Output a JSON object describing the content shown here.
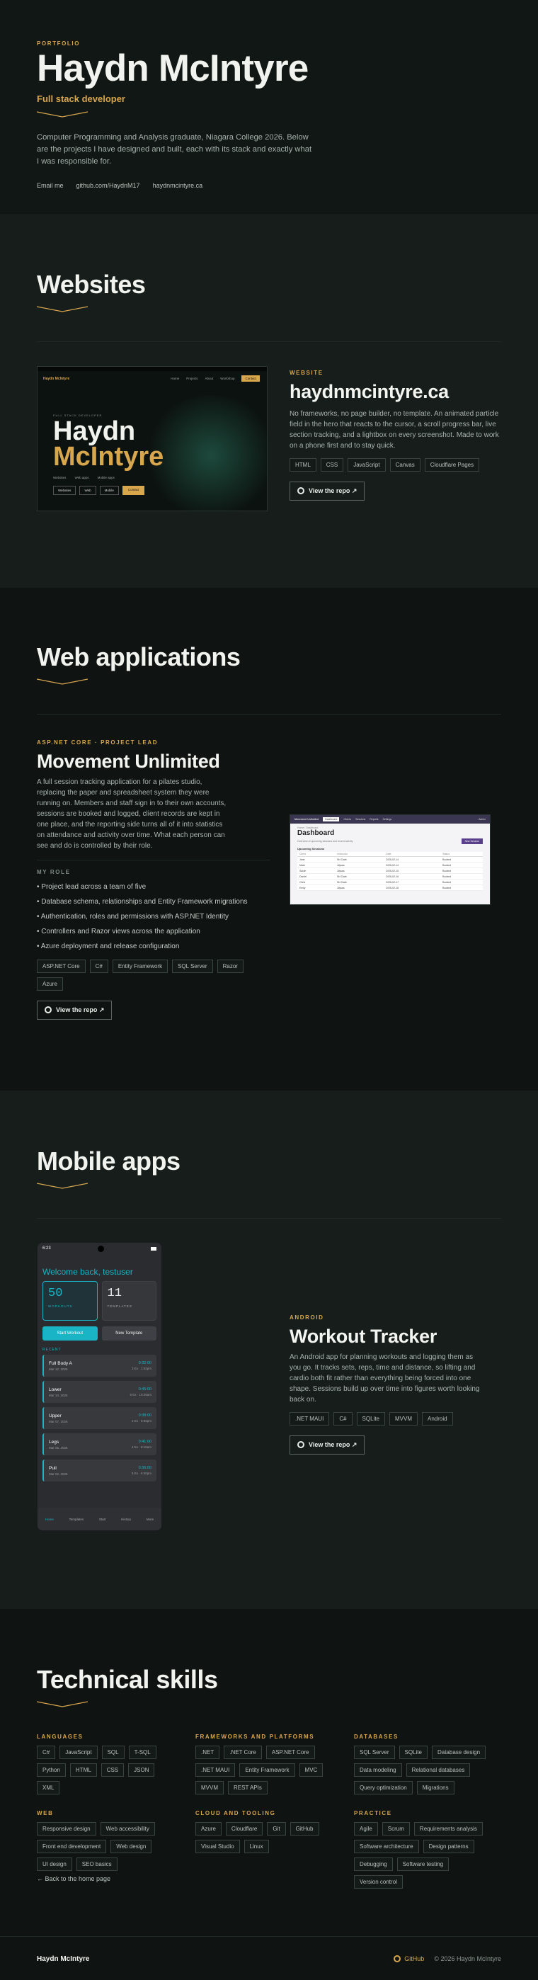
{
  "hero": {
    "eyebrow": "PORTFOLIO",
    "name": "Haydn McIntyre",
    "role": "Full stack developer",
    "intro": "Computer Programming and Analysis graduate, Niagara College 2026. Below are the projects I have designed and built, each with its stack and exactly what I was responsible for.",
    "links": [
      "Email me",
      "github.com/HaydnM17",
      "haydnmcintyre.ca"
    ]
  },
  "websites": {
    "heading": "Websites",
    "eyebrow": "WEBSITE",
    "title": "haydnmcintyre.ca",
    "desc": "No frameworks, no page builder, no template. An animated particle field in the hero that reacts to the cursor, a scroll progress bar, live section tracking, and a lightbox on every screenshot. Made to work on a phone first and to stay quick.",
    "tags": [
      "HTML",
      "CSS",
      "JavaScript",
      "Canvas",
      "Cloudflare Pages"
    ],
    "repo": "View the repo ↗",
    "shot": {
      "logo": "Haydn McIntyre",
      "nav": [
        "Home",
        "Projects",
        "About",
        "Workshop"
      ],
      "cta": "Contact",
      "kicker": "FULL STACK DEVELOPER",
      "name1": "Haydn",
      "name2": "McIntyre",
      "stats": [
        "Websites",
        "Web apps",
        "Mobile apps"
      ],
      "btns": [
        "Websites",
        "Web",
        "Mobile",
        "Contact"
      ]
    }
  },
  "webapps": {
    "heading": "Web applications",
    "eyebrow": "ASP.NET CORE · PROJECT LEAD",
    "title": "Movement Unlimited",
    "desc": "A full session tracking application for a pilates studio, replacing the paper and spreadsheet system they were running on. Members and staff sign in to their own accounts, sessions are booked and logged, client records are kept in one place, and the reporting side turns all of it into statistics on attendance and activity over time. What each person can see and do is controlled by their role.",
    "role_label": "MY ROLE",
    "bullets": [
      "Project lead across a team of five",
      "Database schema, relationships and Entity Framework migrations",
      "Authentication, roles and permissions with ASP.NET Identity",
      "Controllers and Razor views across the application",
      "Azure deployment and release configuration"
    ],
    "tags": [
      "ASP.NET Core",
      "C#",
      "Entity Framework",
      "SQL Server",
      "Razor",
      "Azure"
    ],
    "repo": "View the repo ↗",
    "shot": {
      "brand": "Movement Unlimited",
      "nav": [
        "Dashboard",
        "Clients",
        "Sessions",
        "Reports",
        "Settings"
      ],
      "user": "Admin",
      "crumb": "Home / Dashboard",
      "title": "Dashboard",
      "sub": "Overview of upcoming sessions and recent activity",
      "btn": "New Session",
      "table_title": "Upcoming Sessions",
      "cols": [
        "Client",
        "Instructor",
        "Date",
        "Status"
      ],
      "rows": [
        [
          "Jane",
          "Bri Clark",
          "2026-02-14",
          "Booked"
        ],
        [
          "Mark",
          "Alyssa",
          "2026-02-14",
          "Booked"
        ],
        [
          "Sarah",
          "Alyssa",
          "2026-02-15",
          "Booked"
        ],
        [
          "Daniel",
          "Bri Clark",
          "2026-02-16",
          "Booked"
        ],
        [
          "Chris",
          "Bri Clark",
          "2026-02-17",
          "Booked"
        ],
        [
          "Emily",
          "Alyssa",
          "2026-02-18",
          "Booked"
        ]
      ]
    }
  },
  "mobile": {
    "heading": "Mobile apps",
    "eyebrow": "ANDROID",
    "title": "Workout Tracker",
    "desc": "An Android app for planning workouts and logging them as you go. It tracks sets, reps, time and distance, so lifting and cardio both fit rather than everything being forced into one shape. Sessions build up over time into figures worth looking back on.",
    "tags": [
      ".NET MAUI",
      "C#",
      "SQLite",
      "MVVM",
      "Android"
    ],
    "repo": "View the repo ↗",
    "phone": {
      "time": "6:23",
      "welcome": "Welcome back, testuser",
      "stat1": {
        "value": "50",
        "label": "WORKOUTS"
      },
      "stat2": {
        "value": "11",
        "label": "TEMPLATES"
      },
      "btn1": "Start Workout",
      "btn2": "New Template",
      "recent": "RECENT",
      "workouts": [
        {
          "name": "Full Body A",
          "date": "Mar 12, 2026",
          "dur": "0:32:00",
          "sets": "3 Ex · 1:02pm"
        },
        {
          "name": "Lower",
          "date": "Mar 10, 2026",
          "dur": "0:45:00",
          "sets": "5 Ex · 10:45am"
        },
        {
          "name": "Upper",
          "date": "Mar 07, 2026",
          "dur": "0:38:00",
          "sets": "4 Ex · 5:55pm"
        },
        {
          "name": "Legs",
          "date": "Mar 05, 2026",
          "dur": "0:41:00",
          "sets": "4 Ex · 8:15am"
        },
        {
          "name": "Pull",
          "date": "Mar 02, 2026",
          "dur": "0:36:00",
          "sets": "5 Ex · 6:40pm"
        }
      ],
      "nav": [
        "Home",
        "Templates",
        "Start",
        "History",
        "More"
      ]
    }
  },
  "skills": {
    "heading": "Technical skills",
    "groups": [
      {
        "title": "LANGUAGES",
        "items": [
          "C#",
          "JavaScript",
          "SQL",
          "T-SQL",
          "Python",
          "HTML",
          "CSS",
          "JSON",
          "XML"
        ]
      },
      {
        "title": "FRAMEWORKS AND PLATFORMS",
        "items": [
          ".NET",
          ".NET Core",
          "ASP.NET Core",
          ".NET MAUI",
          "Entity Framework",
          "MVC",
          "MVVM",
          "REST APIs"
        ]
      },
      {
        "title": "DATABASES",
        "items": [
          "SQL Server",
          "SQLite",
          "Database design",
          "Data modeling",
          "Relational databases",
          "Query optimization",
          "Migrations"
        ]
      },
      {
        "title": "WEB",
        "items": [
          "Responsive design",
          "Web accessibility",
          "Front end development",
          "Web design",
          "UI design",
          "SEO basics"
        ]
      },
      {
        "title": "CLOUD AND TOOLING",
        "items": [
          "Azure",
          "Cloudflare",
          "Git",
          "GitHub",
          "Visual Studio",
          "Linux"
        ]
      },
      {
        "title": "PRACTICE",
        "items": [
          "Agile",
          "Scrum",
          "Requirements analysis",
          "Software architecture",
          "Design patterns",
          "Debugging",
          "Software testing",
          "Version control"
        ]
      }
    ],
    "back": "← Back to the home page"
  },
  "footer": {
    "name": "Haydn McIntyre",
    "github": "GitHub",
    "copy": "© 2026 Haydn McIntyre"
  }
}
